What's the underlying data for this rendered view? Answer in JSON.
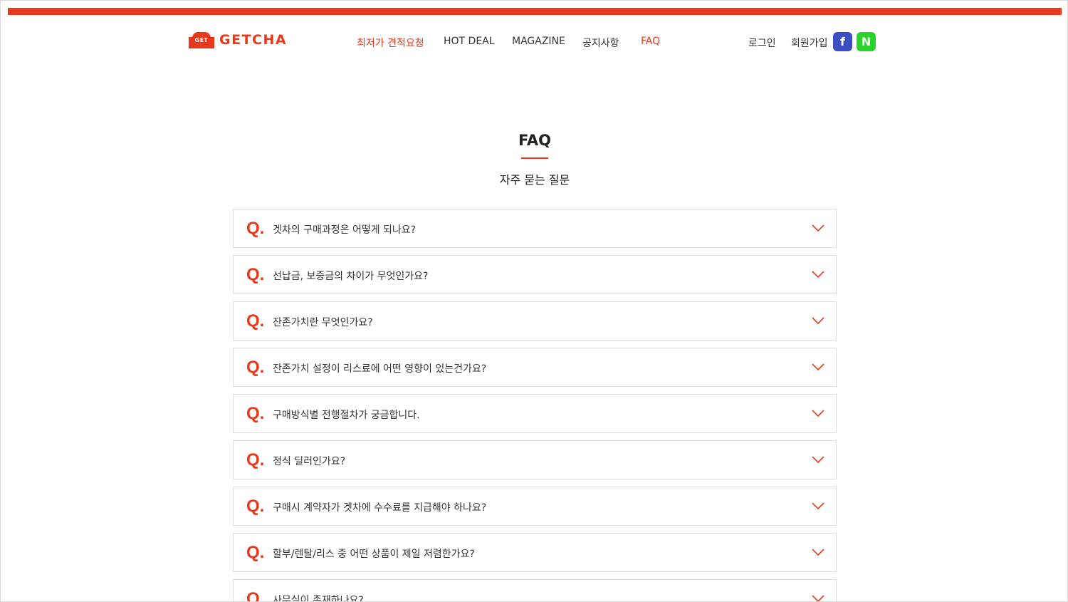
{
  "brand": {
    "badge": "GET",
    "name": "GETCHA",
    "color": "#e8391d"
  },
  "nav": {
    "items": [
      {
        "label": "최저가 견적요청",
        "active": true
      },
      {
        "label": "HOT DEAL",
        "active": false
      },
      {
        "label": "MAGAZINE",
        "active": false
      },
      {
        "label": "공지사항",
        "active": false
      },
      {
        "label": "FAQ",
        "active": true
      }
    ]
  },
  "utility": {
    "login": "로그인",
    "signup": "회원가입",
    "facebook_glyph": "f",
    "naver_glyph": "N"
  },
  "page": {
    "title": "FAQ",
    "subtitle": "자주 묻는 질문"
  },
  "faq": {
    "marker": "Q.",
    "items": [
      "겟차의 구매과정은 어떻게 되나요?",
      "선납금, 보증금의 차이가 무엇인가요?",
      "잔존가치란 무엇인가요?",
      "잔존가치 설정이 리스료에 어떤 영향이 있는건가요?",
      "구매방식별 전행절차가 궁금합니다.",
      "정식 딜러인가요?",
      "구매시 계약자가 겟차에 수수료를 지급해야 하나요?",
      "할부/렌탈/리스 중 어떤 상품이 제일 저렴한가요?",
      "사무실이 존재하나요?"
    ]
  },
  "icons": {
    "expand": "chevron-down-icon",
    "facebook": "facebook-icon",
    "naver": "naver-icon"
  }
}
